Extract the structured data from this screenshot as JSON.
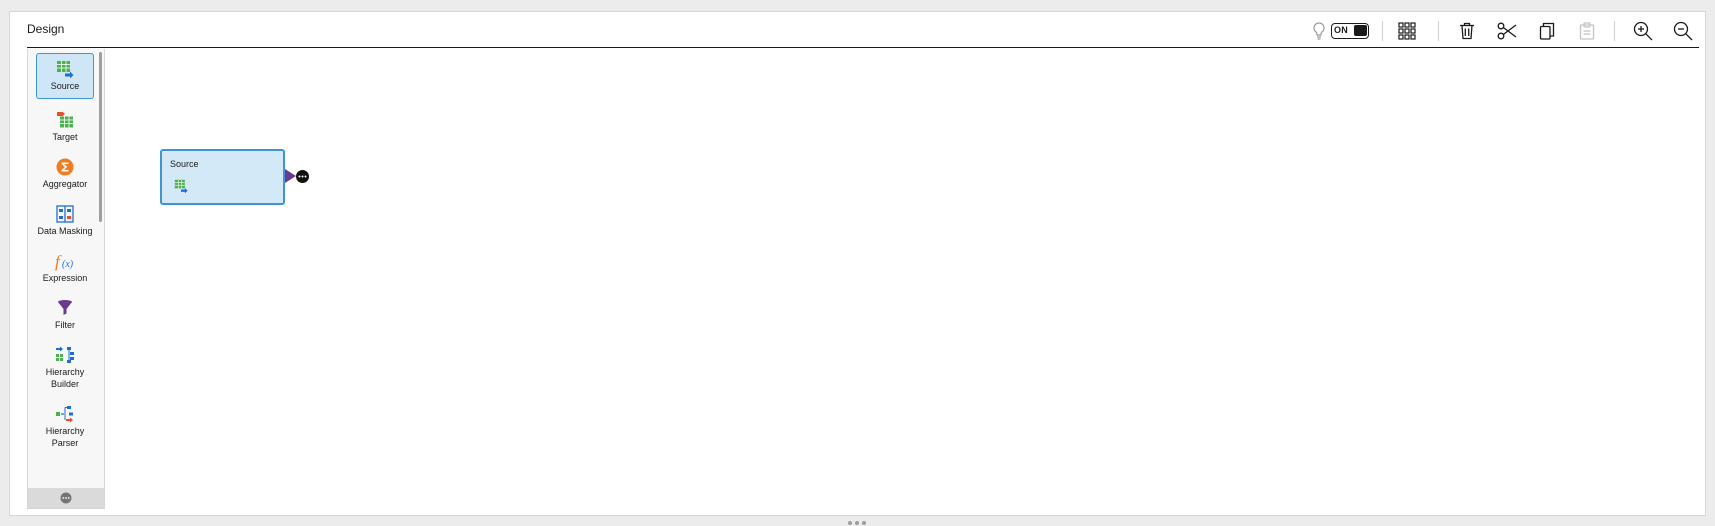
{
  "header": {
    "title": "Design"
  },
  "toolbar": {
    "recommendations_icon": "lightbulb-icon",
    "toggle_label": "ON",
    "buttons": [
      "arrange-grid-icon",
      "delete-icon",
      "cut-icon",
      "copy-icon",
      "paste-icon",
      "zoom-in-icon",
      "zoom-out-icon"
    ]
  },
  "palette": {
    "items": [
      {
        "label": "Source",
        "icon": "source-icon",
        "selected": true
      },
      {
        "label": "Target",
        "icon": "target-icon"
      },
      {
        "label": "Aggregator",
        "icon": "aggregator-icon"
      },
      {
        "label": "Data Masking",
        "icon": "data-masking-icon"
      },
      {
        "label": "Expression",
        "icon": "expression-icon"
      },
      {
        "label": "Filter",
        "icon": "filter-icon"
      },
      {
        "label": "Hierarchy Builder",
        "icon": "hierarchy-builder-icon"
      },
      {
        "label": "Hierarchy Parser",
        "icon": "hierarchy-parser-icon"
      }
    ]
  },
  "canvas": {
    "nodes": [
      {
        "label": "Source",
        "type": "source"
      }
    ]
  },
  "colors": {
    "accent": "#3e95cf",
    "node_fill": "#d4e9f8",
    "port": "#6a3c91",
    "table_green": "#4caf50",
    "arrow_blue": "#1f6fd1",
    "aggregator_orange": "#f07c1f"
  }
}
